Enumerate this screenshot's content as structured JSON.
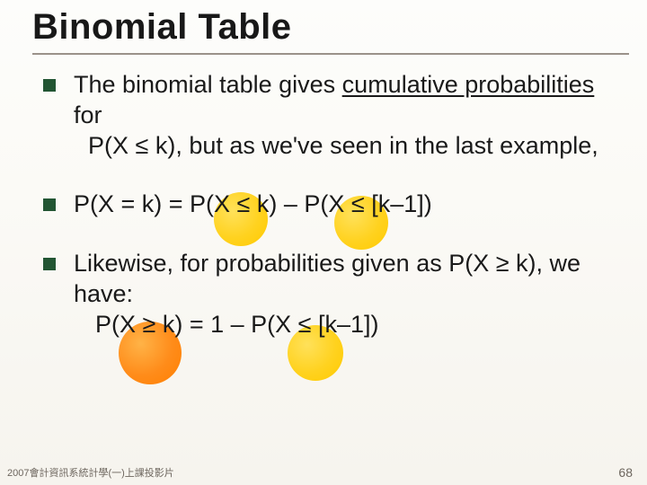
{
  "title": "Binomial Table",
  "bullets": [
    {
      "pre": "The binomial table gives ",
      "underline": "cumulative probabilities",
      "post": " for",
      "line2": "P(X ≤ k), but as we've seen in the last example,"
    },
    {
      "text": "P(X = k) = P(X ≤ k) – P(X ≤ [k–1])"
    },
    {
      "line1": "Likewise, for probabilities given as P(X ≥ k), we have:",
      "line2": "P(X ≥ k) = 1 – P(X ≤ [k–1])"
    }
  ],
  "footer_left": "2007會計資訊系統計學(一)上課投影片",
  "page_number": "68"
}
